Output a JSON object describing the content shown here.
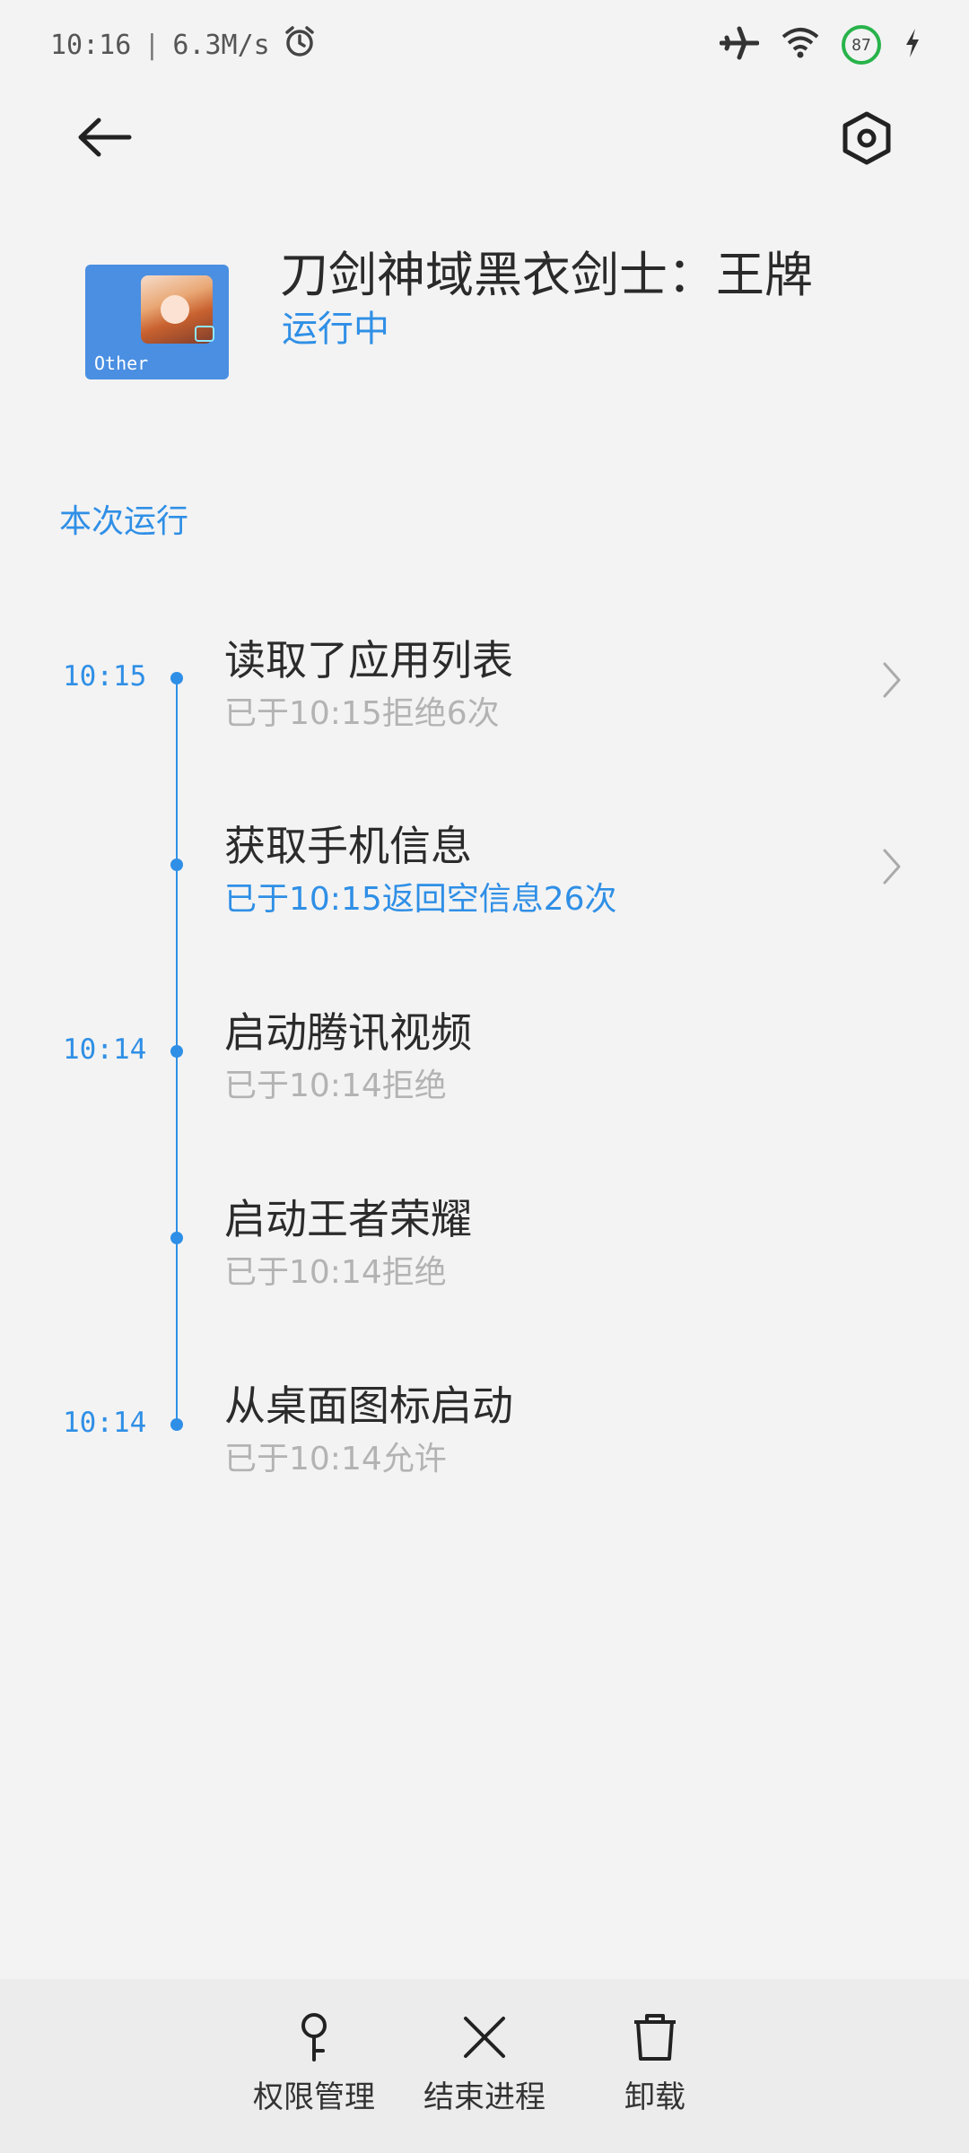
{
  "status_bar": {
    "time": "10:16",
    "separator": "|",
    "speed": "6.3M/s",
    "battery": "87",
    "icons": [
      "alarm-icon",
      "airplane-icon",
      "wifi-icon",
      "charging-icon"
    ]
  },
  "header": {
    "back_icon": "back-arrow-icon",
    "settings_icon": "settings-hex-icon"
  },
  "app": {
    "name": "刀剑神域黑衣剑士：王牌",
    "status": "运行中",
    "icon_tag": "Other"
  },
  "section": {
    "title": "本次运行"
  },
  "events": [
    {
      "time": "10:15",
      "title": "读取了应用列表",
      "detail": "已于10:15拒绝6次",
      "detail_color": "gray",
      "has_chevron": true
    },
    {
      "time": "",
      "title": "获取手机信息",
      "detail": "已于10:15返回空信息26次",
      "detail_color": "blue",
      "has_chevron": true
    },
    {
      "time": "10:14",
      "title": "启动腾讯视频",
      "detail": "已于10:14拒绝",
      "detail_color": "gray",
      "has_chevron": false
    },
    {
      "time": "",
      "title": "启动王者荣耀",
      "detail": "已于10:14拒绝",
      "detail_color": "gray",
      "has_chevron": false
    },
    {
      "time": "10:14",
      "title": "从桌面图标启动",
      "detail": "已于10:14允许",
      "detail_color": "gray",
      "has_chevron": false
    }
  ],
  "toolbar": {
    "permissions_label": "权限管理",
    "end_process_label": "结束进程",
    "uninstall_label": "卸载"
  },
  "colors": {
    "accent": "#2f8fe6",
    "background": "#f3f3f3",
    "muted_text": "#b3b3b3",
    "battery_ring": "#28b34a"
  }
}
